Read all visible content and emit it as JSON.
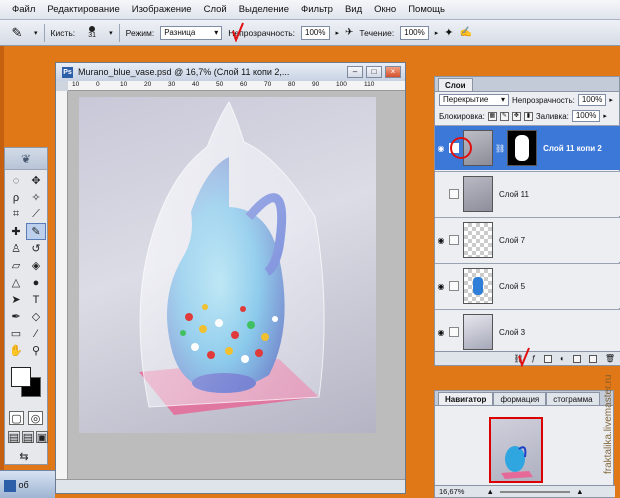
{
  "menubar": {
    "items": [
      "Файл",
      "Редактирование",
      "Изображение",
      "Слой",
      "Выделение",
      "Фильтр",
      "Вид",
      "Окно",
      "Помощь"
    ]
  },
  "options": {
    "brush_label": "Кисть:",
    "brush_size": "31",
    "mode_label": "Режим:",
    "mode_value": "Разница",
    "opacity_label": "Непрозрачность:",
    "opacity_value": "100%",
    "flow_label": "Течение:",
    "flow_value": "100%"
  },
  "document": {
    "title": "Murano_blue_vase.psd @ 16,7% (Слой 11 копи 2,...",
    "ruler_ticks": [
      "10",
      "0",
      "10",
      "20",
      "30",
      "40",
      "50",
      "60",
      "70",
      "80",
      "90",
      "100",
      "110"
    ]
  },
  "layers_panel": {
    "tab": "Слои",
    "blend_mode": "Перекрытие",
    "opacity_label": "Непрозрачность:",
    "opacity_value": "100%",
    "lock_label": "Блокировка:",
    "fill_label": "Заливка:",
    "fill_value": "100%",
    "layers": [
      {
        "name": "Слой 11 копи 2",
        "selected": true
      },
      {
        "name": "Слой 11",
        "selected": false
      },
      {
        "name": "Слой 7",
        "selected": false
      },
      {
        "name": "Слой 5",
        "selected": false
      },
      {
        "name": "Слой 3",
        "selected": false
      }
    ]
  },
  "navigator": {
    "tabs": [
      "Навигатор",
      "формация",
      "стограмма"
    ],
    "zoom": "16,67%"
  },
  "taskbar": {
    "label": "об"
  },
  "watermark": "fraktalika.livemaster.ru",
  "colors": {
    "accent_red": "#e01010",
    "selection_blue": "#3b78d8",
    "desktop_orange": "#e07818"
  }
}
